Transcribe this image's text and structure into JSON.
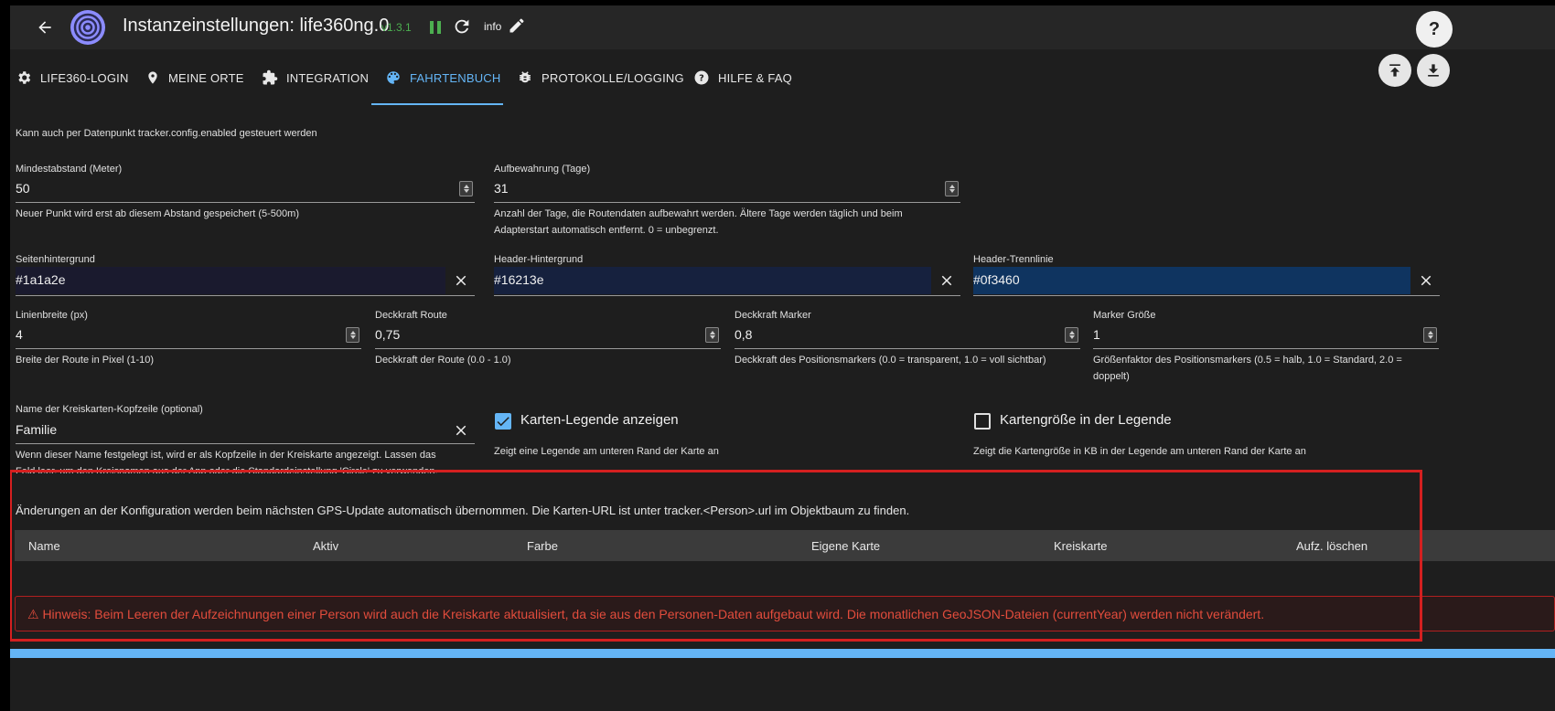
{
  "header": {
    "title": "Instanzeinstellungen: life360ng.0",
    "version": "v1.3.1",
    "log_label": "info"
  },
  "tabs": [
    {
      "label": "LIFE360-LOGIN",
      "icon": "gear-icon"
    },
    {
      "label": "MEINE ORTE",
      "icon": "location-pin-icon"
    },
    {
      "label": "INTEGRATION",
      "icon": "puzzle-icon"
    },
    {
      "label": "FAHRTENBUCH",
      "icon": "palette-icon",
      "active": true
    },
    {
      "label": "PROTOKOLLE/LOGGING",
      "icon": "bug-icon"
    },
    {
      "label": "HILFE & FAQ",
      "icon": "help-icon"
    }
  ],
  "form": {
    "intro": "Kann auch per Datenpunkt tracker.config.enabled gesteuert werden",
    "min_distance": {
      "label": "Mindestabstand (Meter)",
      "value": "50",
      "help": "Neuer Punkt wird erst ab diesem Abstand gespeichert (5-500m)"
    },
    "retention": {
      "label": "Aufbewahrung (Tage)",
      "value": "31",
      "help_line1": "Anzahl der Tage, die Routendaten aufbewahrt werden. Ältere Tage werden täglich und beim",
      "help_line2": "Adapterstart automatisch entfernt. 0 = unbegrenzt."
    },
    "page_bg": {
      "label": "Seitenhintergrund",
      "value": "#1a1a2e"
    },
    "header_bg": {
      "label": "Header-Hintergrund",
      "value": "#16213e"
    },
    "header_line": {
      "label": "Header-Trennlinie",
      "value": "#0f3460"
    },
    "line_width": {
      "label": "Linienbreite (px)",
      "value": "4",
      "help": "Breite der Route in Pixel (1-10)"
    },
    "route_opacity": {
      "label": "Deckkraft Route",
      "value": "0,75",
      "help": "Deckkraft der Route (0.0 - 1.0)"
    },
    "marker_opacity": {
      "label": "Deckkraft Marker",
      "value": "0,8",
      "help": "Deckkraft des Positionsmarkers (0.0 = transparent, 1.0 = voll sichtbar)"
    },
    "marker_size": {
      "label": "Marker Größe",
      "value": "1",
      "help_line1": "Größenfaktor des Positionsmarkers (0.5 = halb, 1.0 = Standard, 2.0 =",
      "help_line2": "doppelt)"
    },
    "circle_header": {
      "label": "Name der Kreiskarten-Kopfzeile (optional)",
      "value": "Familie",
      "help_line1": "Wenn dieser Name festgelegt ist, wird er als Kopfzeile in der Kreiskarte angezeigt. Lassen das",
      "help_line2": "Feld leer, um den Kreisnamen aus der App oder die Standardeinstellung 'Circle' zu verwenden."
    },
    "show_legend": {
      "label": "Karten-Legende anzeigen",
      "checked": true,
      "help": "Zeigt eine Legende am unteren Rand der Karte an"
    },
    "map_size_legend": {
      "label": "Kartengröße in der Legende",
      "checked": false,
      "help": "Zeigt die Kartengröße in KB in der Legende am unteren Rand der Karte an"
    }
  },
  "note": "Änderungen an der Konfiguration werden beim nächsten GPS-Update automatisch übernommen. Die Karten-URL ist unter tracker.<Person>.url im Objektbaum zu finden.",
  "table": {
    "columns": [
      "Name",
      "Aktiv",
      "Farbe",
      "Eigene Karte",
      "Kreiskarte",
      "Aufz. löschen"
    ]
  },
  "warning": "⚠ Hinweis: Beim Leeren der Aufzeichnungen einer Person wird auch die Kreiskarte aktualisiert, da sie aus den Personen-Daten aufgebaut wird. Die monatlichen GeoJSON-Dateien (currentYear) werden nicht verändert.",
  "colors": {
    "accent": "#64b5f6",
    "page_swatch": "#1a1a2e",
    "header_swatch": "#16213e",
    "line_swatch": "#0f3460",
    "warning": "#e24c3c"
  }
}
